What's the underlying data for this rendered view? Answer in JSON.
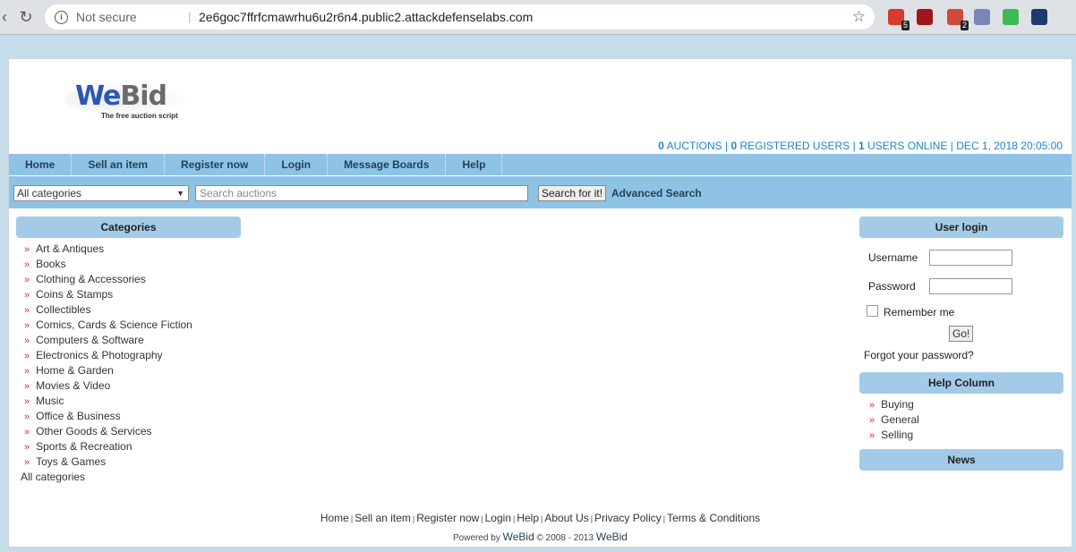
{
  "browser": {
    "security": "Not secure",
    "separator": "|",
    "url": "2e6goc7ffrfcmawrhu6u2r6n4.public2.attackdefenselabs.com",
    "extensions": [
      {
        "name": "todoist-icon",
        "badge": "5",
        "color": "#d63b2f"
      },
      {
        "name": "ublock-icon",
        "badge": "",
        "color": "#a0161b"
      },
      {
        "name": "hackbar-icon",
        "badge": "2",
        "color": "#d04a3a"
      },
      {
        "name": "php-icon",
        "badge": "",
        "color": "#7a86b8"
      },
      {
        "name": "js-toggle-icon",
        "badge": "",
        "color": "#3cba54"
      },
      {
        "name": "globe-icon",
        "badge": "",
        "color": "#1f3a6e"
      }
    ]
  },
  "logo": {
    "we": "We",
    "bid": "Bid",
    "tagline": "The free auction script"
  },
  "stats": {
    "auctions_count": "0",
    "auctions_label": "AUCTIONS",
    "registered_count": "0",
    "registered_label": "REGISTERED USERS",
    "online_count": "1",
    "online_label": "USERS ONLINE",
    "datetime": "DEC 1, 2018 20:05:00",
    "separator": "|"
  },
  "nav": [
    {
      "label": "Home"
    },
    {
      "label": "Sell an item"
    },
    {
      "label": "Register now"
    },
    {
      "label": "Login"
    },
    {
      "label": "Message Boards"
    },
    {
      "label": "Help"
    }
  ],
  "search": {
    "category_selected": "All categories",
    "placeholder": "Search auctions",
    "button": "Search for it!",
    "advanced": "Advanced Search"
  },
  "categories": {
    "title": "Categories",
    "items": [
      "Art & Antiques",
      "Books",
      "Clothing & Accessories",
      "Coins & Stamps",
      "Collectibles",
      "Comics, Cards & Science Fiction",
      "Computers & Software",
      "Electronics & Photography",
      "Home & Garden",
      "Movies & Video",
      "Music",
      "Office & Business",
      "Other Goods & Services",
      "Sports & Recreation",
      "Toys & Games"
    ],
    "all": "All categories"
  },
  "login": {
    "title": "User login",
    "username_label": "Username",
    "password_label": "Password",
    "remember": "Remember me",
    "go": "Go!",
    "forgot": "Forgot your password?"
  },
  "help": {
    "title": "Help Column",
    "items": [
      "Buying",
      "General",
      "Selling"
    ]
  },
  "news": {
    "title": "News"
  },
  "footer": {
    "links": [
      "Home",
      "Sell an item",
      "Register now",
      "Login",
      "Help",
      "About Us",
      "Privacy Policy",
      "Terms & Conditions"
    ],
    "separator": "|",
    "powered_prefix": "Powered by",
    "powered_brand": "WeBid",
    "copyright": "© 2008 - 2013",
    "copyright_brand": "WeBid"
  }
}
